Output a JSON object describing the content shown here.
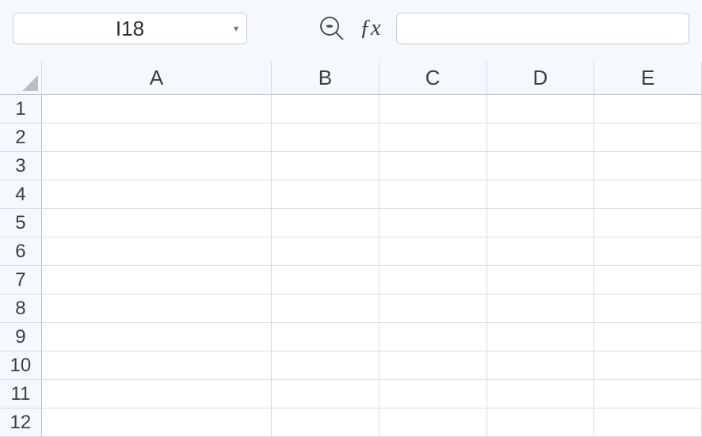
{
  "toolbar": {
    "name_box_value": "I18",
    "fx_label": "ƒx",
    "formula_bar_value": ""
  },
  "grid": {
    "columns": [
      {
        "label": "A",
        "width_class": "col-A"
      },
      {
        "label": "B",
        "width_class": "col-B"
      },
      {
        "label": "C",
        "width_class": "col-C"
      },
      {
        "label": "D",
        "width_class": "col-D"
      },
      {
        "label": "E",
        "width_class": "col-E"
      }
    ],
    "rows": [
      "1",
      "2",
      "3",
      "4",
      "5",
      "6",
      "7",
      "8",
      "9",
      "10",
      "11",
      "12"
    ],
    "cells": {}
  }
}
